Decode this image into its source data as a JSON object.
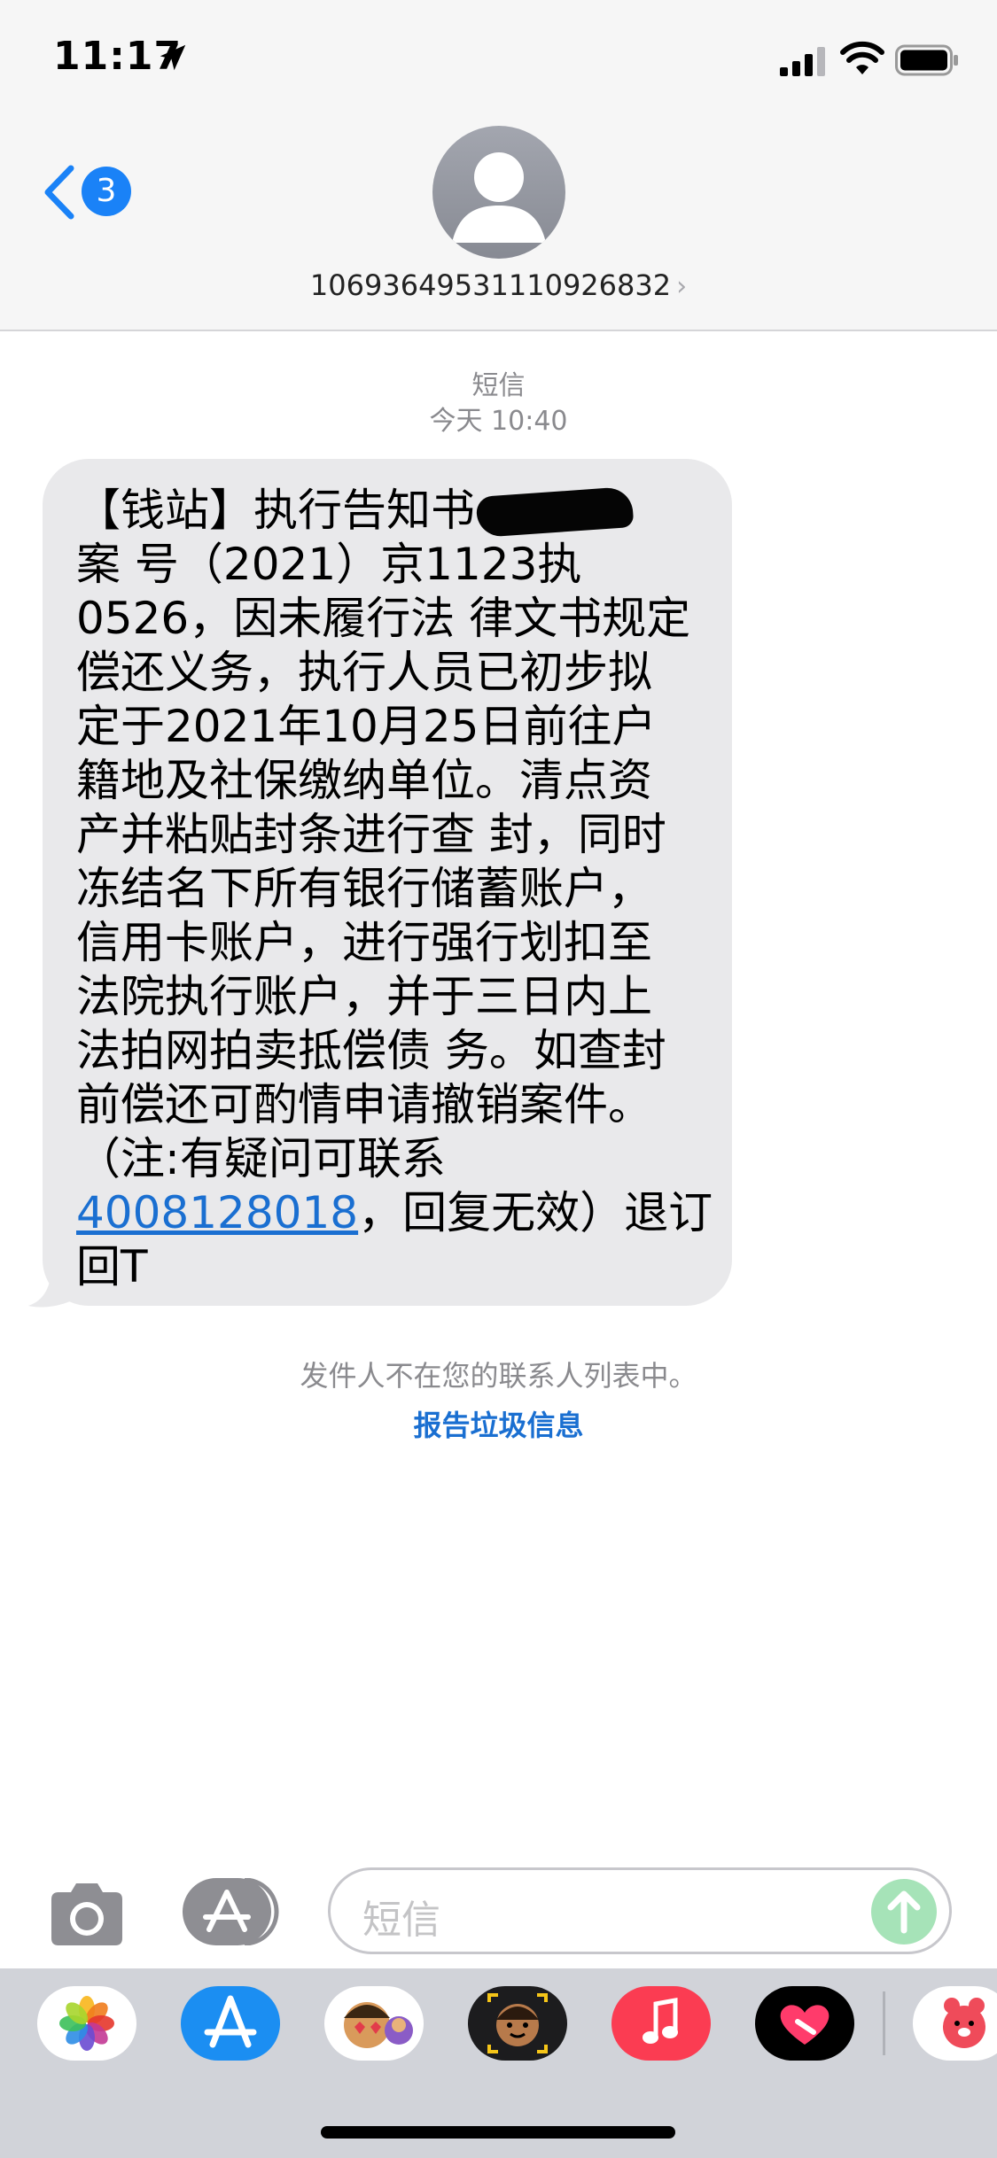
{
  "status_bar": {
    "time": "11:17",
    "icons": [
      "location-arrow-icon",
      "cellular-signal-icon",
      "wifi-icon",
      "battery-icon"
    ]
  },
  "header": {
    "back_badge_count": "3",
    "contact_number": "1069364953111092683​2",
    "chevron": "›"
  },
  "conversation": {
    "service_label": "短信",
    "timestamp": "今天 10:40",
    "message": {
      "lines": [
        "【钱站】执行告知书",
        "案 号（2021）京1123执",
        "0526，因未履行法 律文书规定",
        "偿还义务，执行人员已初步拟",
        "定于2021年10月25日前往户",
        "籍地及社保缴纳单位。清点资",
        "产并粘贴封条进行查 封，同时",
        "冻结名下所有银行储蓄账户，",
        "信用卡账户，进行强行划扣至",
        "法院执行账户，并于三日内上",
        "法拍网拍卖抵偿债 务。如查封",
        "前偿还可酌情申请撤销案件。",
        "（注:有疑问可联系"
      ],
      "phone": "4008128018",
      "after_phone": "，回复无效）退订",
      "last_line": "回T"
    },
    "notice": "发件人不在您的联系人列表中。",
    "report_link": "报告垃圾信息"
  },
  "input_bar": {
    "placeholder": "短信"
  },
  "app_drawer": {
    "apps": [
      "photos-icon",
      "app-store-icon",
      "memoji-stickers-icon",
      "memoji-icon",
      "music-icon",
      "digital-touch-icon",
      "bear-sticker-icon"
    ]
  },
  "colors": {
    "accent": "#1a82f7",
    "bubble": "#e9e9eb",
    "header_bg": "#f6f6f6",
    "send_button": "#a6e3b8",
    "drawer_bg": "#d1d3d9"
  }
}
